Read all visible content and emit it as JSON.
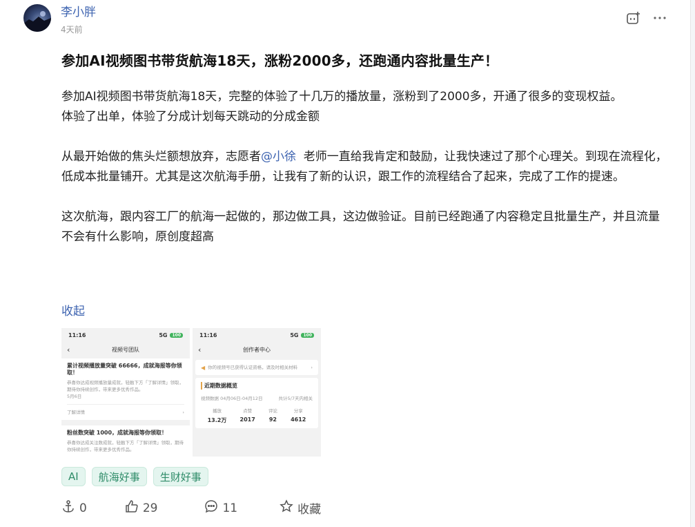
{
  "post": {
    "author": "李小胖",
    "time": "4天前",
    "title": "参加AI视频图书带货航海18天，涨粉2000多，还跑通内容批量生产！",
    "p1": "参加AI视频图书带货航海18天，完整的体验了十几万的播放量，涨粉到了2000多，开通了很多的变现权益。",
    "p2": "体验了出单，体验了分成计划每天跳动的分成金额",
    "p3_before": "从最开始做的焦头烂额想放弃，志愿者",
    "p3_mention": "@小徐",
    "p3_after": "  老师一直给我肯定和鼓励，让我快速过了那个心理关。到现在流程化，低成本批量铺开。尤其是这次航海手册，让我有了新的认识，跟工作的流程结合了起来，完成了工作的提速。",
    "p4": "这次航海，跟内容工厂的航海一起做的，那边做工具，这边做验证。目前已经跑通了内容稳定且批量生产，并且流量不会有什么影响，原创度超高",
    "collapse_label": "收起"
  },
  "screenshot1": {
    "time": "11:16",
    "signal": "5G",
    "battery": "100",
    "title": "视频号团队",
    "msg1_title": "累计视频播放量突破 66666，成就海报等你领取！",
    "msg1_body": "恭喜你达成视频播放量成就，轻触下方「了解详情」领取，期待你持续创作，带来更多优秀作品。",
    "msg1_date": "5月6日",
    "msg1_link": "了解详情",
    "msg2_title": "粉丝数突破 1000，成就海报等你领取！",
    "msg2_body": "恭喜你达成关注数成就，轻触下方「了解详情」领取，期待你持续创作，带来更多优秀作品。"
  },
  "screenshot2": {
    "time": "11:16",
    "signal": "5G",
    "battery": "100",
    "title": "创作者中心",
    "notice": "你的视频号已获得认证资格，请及时相关材料",
    "section": "近期数据概览",
    "range_label": "视频数据",
    "range": "04月06日-04月12日",
    "range_right": "共计5/7天内相关",
    "stat_labels": [
      "播放",
      "点赞",
      "评论",
      "分享"
    ],
    "stat_values": [
      "13.2万",
      "2017",
      "92",
      "4612"
    ]
  },
  "tags": [
    "AI",
    "航海好事",
    "生财好事"
  ],
  "actions": {
    "share_count": "0",
    "like_count": "29",
    "comment_count": "11",
    "favorite_label": "收藏"
  },
  "colors": {
    "link": "#3d63b0",
    "tag_bg": "#e4f5ef",
    "tag_text": "#2e8c68"
  }
}
